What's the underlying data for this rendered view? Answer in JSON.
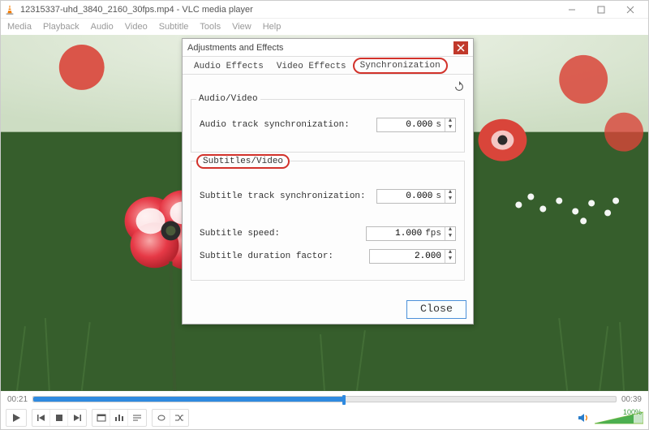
{
  "window": {
    "title": "12315337-uhd_3840_2160_30fps.mp4 - VLC media player"
  },
  "menubar": [
    "Media",
    "Playback",
    "Audio",
    "Video",
    "Subtitle",
    "Tools",
    "View",
    "Help"
  ],
  "dialog": {
    "title": "Adjustments and Effects",
    "tabs": {
      "audio_effects": "Audio Effects",
      "video_effects": "Video Effects",
      "synchronization": "Synchronization"
    },
    "sections": {
      "audio_video": {
        "legend": "Audio/Video",
        "audio_sync_label": "Audio track synchronization:",
        "audio_sync_value": "0.000",
        "audio_sync_unit": "s"
      },
      "subtitles_video": {
        "legend": "Subtitles/Video",
        "subtitle_sync_label": "Subtitle track synchronization:",
        "subtitle_sync_value": "0.000",
        "subtitle_sync_unit": "s",
        "subtitle_speed_label": "Subtitle speed:",
        "subtitle_speed_value": "1.000",
        "subtitle_speed_unit": "fps",
        "subtitle_duration_label": "Subtitle duration factor:",
        "subtitle_duration_value": "2.000"
      }
    },
    "close_label": "Close"
  },
  "playback": {
    "elapsed": "00:21",
    "total": "00:39",
    "progress_percent": 53
  },
  "volume": {
    "percent_label": "100%"
  }
}
